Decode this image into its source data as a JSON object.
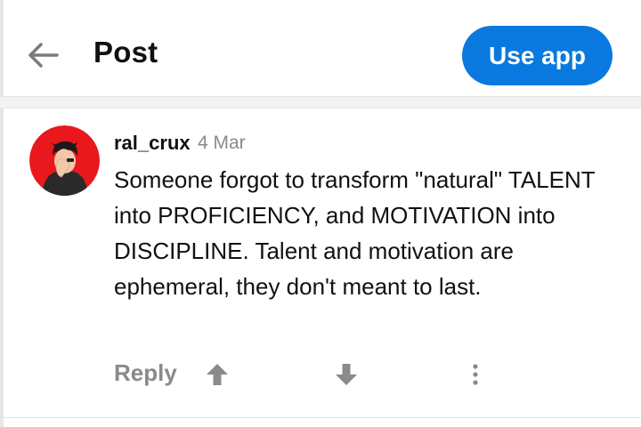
{
  "header": {
    "title": "Post",
    "use_app_label": "Use app",
    "back_icon": "arrow-left-icon"
  },
  "comment": {
    "username": "ral_crux",
    "date": "4 Mar",
    "body": "Someone forgot to transform \"natural\" TALENT into PROFICIENCY, and MOTIVATION into DISCIPLINE. Talent and motivation are ephemeral, they don't meant to last.",
    "actions": {
      "reply_label": "Reply",
      "upvote_icon": "arrow-up-icon",
      "downvote_icon": "arrow-down-icon",
      "more_icon": "more-vertical-icon"
    }
  },
  "colors": {
    "accent": "#0a79df",
    "avatar_bg": "#e8181c",
    "muted": "#8a8a8a"
  }
}
